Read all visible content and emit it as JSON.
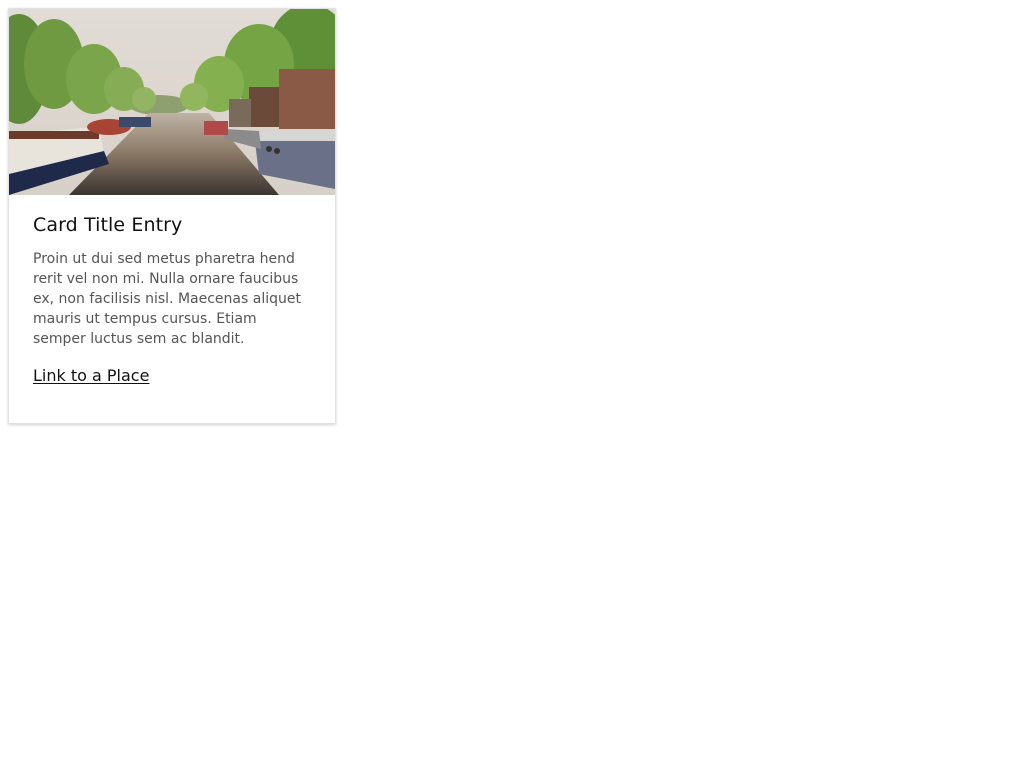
{
  "card": {
    "image_alt": "Canal with houseboats and trees",
    "title": "Card Title Entry",
    "text": "Proin ut dui sed metus pharetra hend rerit vel non mi. Nulla ornare faucibus ex, non facilisis nisl. Maecenas aliquet mauris ut tempus cursus. Etiam semper luctus sem ac blandit.",
    "link_label": "Link to a Place"
  }
}
